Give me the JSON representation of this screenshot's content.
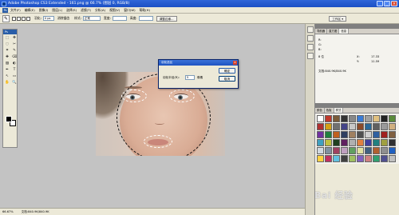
{
  "window": {
    "title": "Adobe Photoshop CS3 Extended - 161.png @ 66.7% (图层 0, RGB/8)",
    "minimize": "_",
    "maximize": "□",
    "close": "×"
  },
  "menu": {
    "logo": "Ps",
    "items": [
      "文件(F)",
      "编辑(E)",
      "图像(I)",
      "图层(L)",
      "选择(S)",
      "滤镜(T)",
      "分析(A)",
      "视图(V)",
      "窗口(W)",
      "帮助(H)"
    ]
  },
  "options": {
    "tool_icon": "✎",
    "feather_label": "羽化:",
    "feather_value": "0 px",
    "antialias_label": "消除锯齿",
    "style_label": "样式:",
    "style_value": "正常",
    "width_label": "宽度:",
    "height_label": "高度:",
    "refine_edge": "调整边缘...",
    "workspace": "工作区 ▾"
  },
  "toolbox": {
    "header": "Ps",
    "tools": [
      "⬚",
      "✥",
      "◌",
      "✂",
      "⌗",
      "✎",
      "✚",
      "⌫",
      "▨",
      "◐",
      "✒",
      "T",
      "↖",
      "▭",
      "✋",
      "🔍"
    ]
  },
  "dialog": {
    "title": "羽化选区",
    "close": "×",
    "radius_label": "羽化半径(R):",
    "radius_value": "5",
    "unit": "像素",
    "ok": "确定",
    "cancel": "取消"
  },
  "status": {
    "zoom": "66.67%",
    "doc": "文档:840.9K/840.9K"
  },
  "panels": {
    "info_tabs": [
      "导航器",
      "直方图",
      "信息"
    ],
    "info_rows": [
      {
        "k": "R:",
        "v": ""
      },
      {
        "k": "G:",
        "v": ""
      },
      {
        "k": "B:",
        "v": ""
      },
      {
        "k": "8 位",
        "v": ""
      },
      {
        "k": "X:",
        "v": "17.33"
      },
      {
        "k": "Y:",
        "v": "11.59"
      }
    ],
    "doc_size": "文档:840.9K/840.9K",
    "styles_tabs": [
      "颜色",
      "色板",
      "样式"
    ],
    "styles_colors": [
      "#ffffff",
      "#c0392b",
      "#7a5c3a",
      "#333333",
      "#888888",
      "#3a7bd5",
      "#a0a0a0",
      "#e0c080",
      "#222222",
      "#5a8a3a",
      "#b03030",
      "#d4a017",
      "#707070",
      "#444488",
      "#c8c8c8",
      "#8a4a2a",
      "#2a6a9a",
      "#606060",
      "#9a9a9a",
      "#d0b080",
      "#7030a0",
      "#208040",
      "#c06020",
      "#304060",
      "#a08060",
      "#505050",
      "#d0d0d0",
      "#3060a0",
      "#a02020",
      "#806040",
      "#40a0c0",
      "#c0c040",
      "#204020",
      "#602060",
      "#b0b0b0",
      "#e08040",
      "#4040a0",
      "#208080",
      "#a0a040",
      "#303030",
      "#d0d8e0",
      "#8090a0",
      "#a04060",
      "#c0a0c0",
      "#60a060",
      "#e0e0a0",
      "#406080",
      "#b06030",
      "#909090",
      "#2060c0",
      "#ffd040",
      "#c03060",
      "#60c0e0",
      "#404040",
      "#a0c060",
      "#8060c0",
      "#d08080",
      "#30a070",
      "#505090",
      "#c0c0c0"
    ]
  },
  "watermark": "Bai 经验"
}
